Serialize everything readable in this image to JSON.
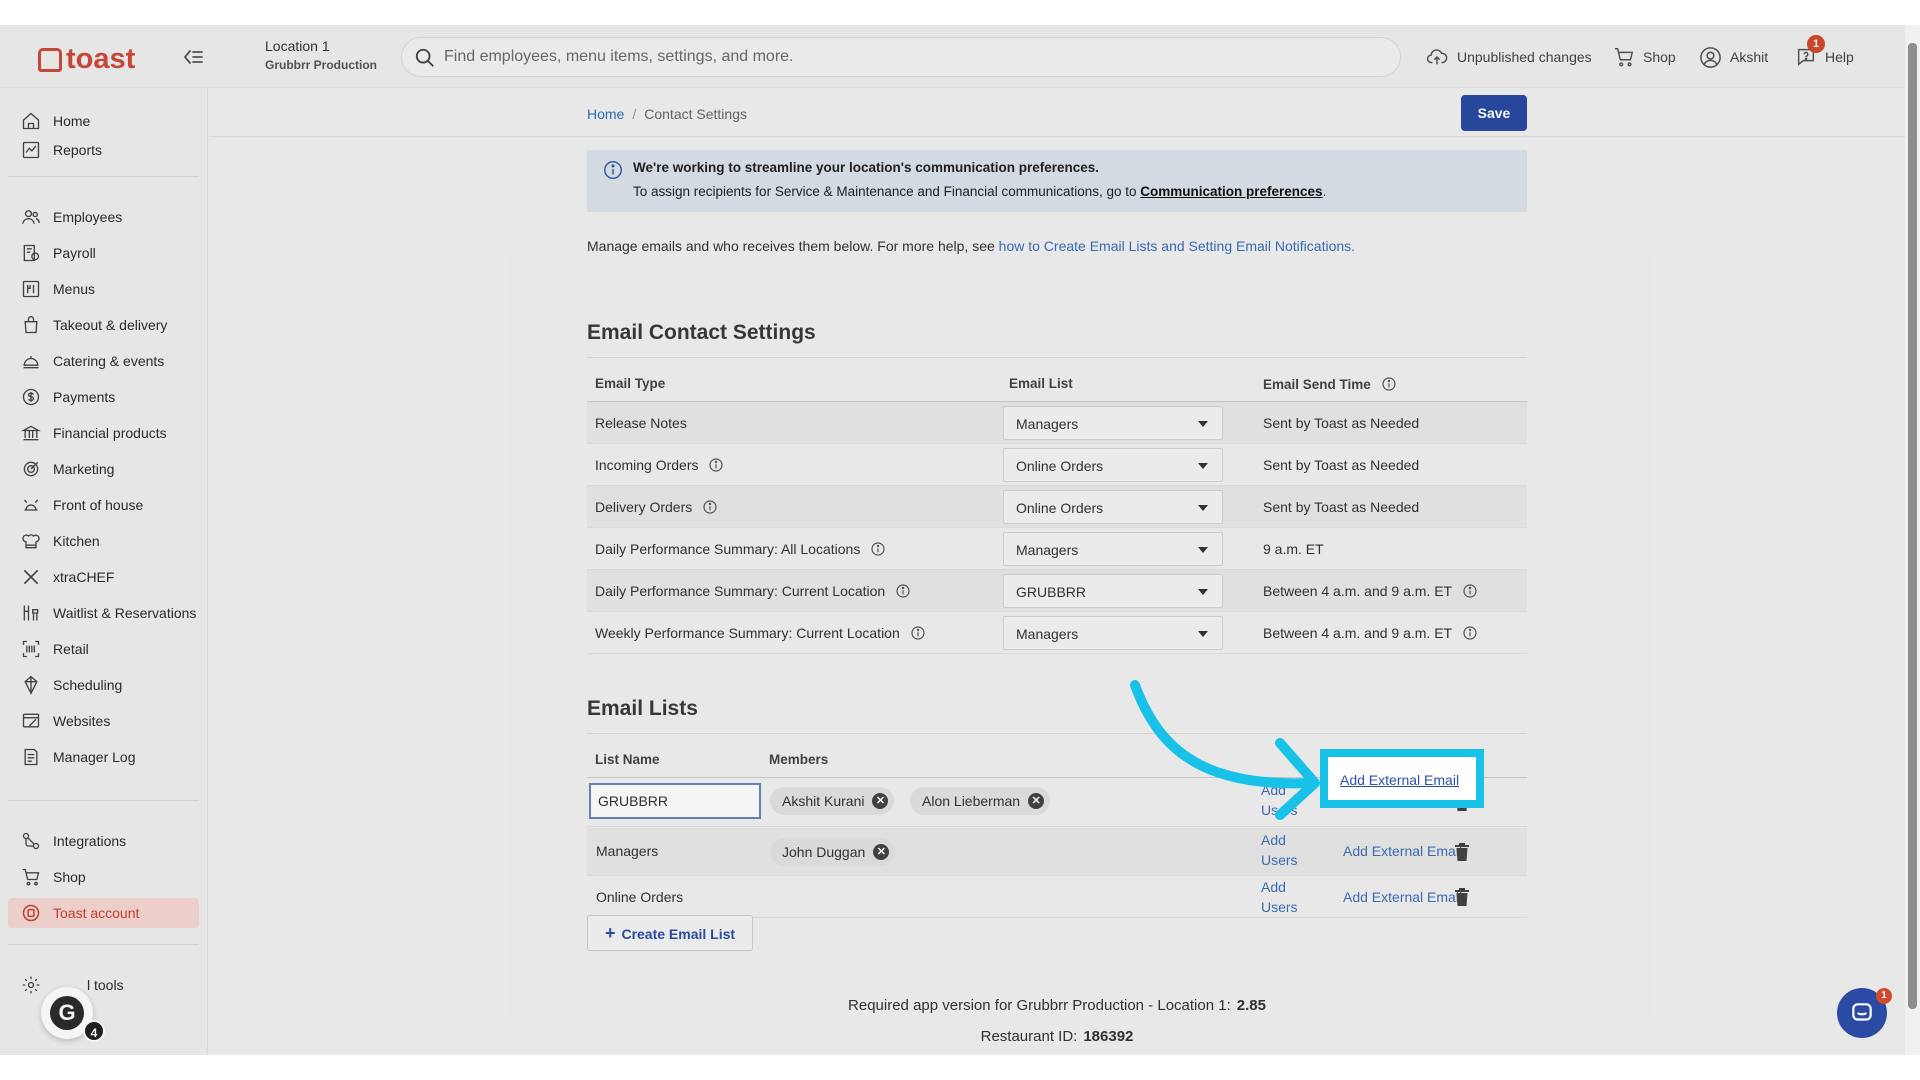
{
  "topbar": {
    "logo_text": "toast",
    "location_name": "Location 1",
    "location_sub": "Grubbrr Production",
    "search_placeholder": "Find employees, menu items, settings, and more.",
    "unpublished_label": "Unpublished changes",
    "shop_label": "Shop",
    "user_label": "Akshit",
    "help_label": "Help",
    "help_badge": "1"
  },
  "sidebar": {
    "items": [
      {
        "label": "Home",
        "icon": "home-icon"
      },
      {
        "label": "Reports",
        "icon": "reports-icon"
      },
      {
        "label": "Employees",
        "icon": "employees-icon"
      },
      {
        "label": "Payroll",
        "icon": "payroll-icon"
      },
      {
        "label": "Menus",
        "icon": "menus-icon"
      },
      {
        "label": "Takeout & delivery",
        "icon": "takeout-icon"
      },
      {
        "label": "Catering & events",
        "icon": "catering-icon"
      },
      {
        "label": "Payments",
        "icon": "payments-icon"
      },
      {
        "label": "Financial products",
        "icon": "bank-icon"
      },
      {
        "label": "Marketing",
        "icon": "marketing-icon"
      },
      {
        "label": "Front of house",
        "icon": "front-of-house-icon"
      },
      {
        "label": "Kitchen",
        "icon": "kitchen-icon"
      },
      {
        "label": "xtraCHEF",
        "icon": "xtrachef-icon"
      },
      {
        "label": "Waitlist & Reservations",
        "icon": "waitlist-icon"
      },
      {
        "label": "Retail",
        "icon": "retail-icon"
      },
      {
        "label": "Scheduling",
        "icon": "scheduling-icon"
      },
      {
        "label": "Websites",
        "icon": "websites-icon"
      },
      {
        "label": "Manager Log",
        "icon": "manager-log-icon"
      },
      {
        "label": "Integrations",
        "icon": "integrations-icon"
      },
      {
        "label": "Shop",
        "icon": "cart-icon"
      },
      {
        "label": "Toast account",
        "icon": "toast-account-icon"
      },
      {
        "label": "l tools",
        "icon": "gear-icon"
      }
    ],
    "avatar_letter": "G",
    "avatar_count": "4"
  },
  "breadcrumb": {
    "home": "Home",
    "current": "Contact Settings"
  },
  "save_label": "Save",
  "banner": {
    "title": "We're working to streamline your location's communication preferences.",
    "body": "To assign recipients for Service & Maintenance and Financial communications, go to ",
    "link": "Communication preferences",
    "end": "."
  },
  "intro": {
    "text": "Manage emails and who receives them below. For more help, see ",
    "link": "how to Create Email Lists and Setting Email Notifications."
  },
  "email_contact": {
    "heading": "Email Contact Settings",
    "headers": {
      "type": "Email Type",
      "list": "Email List",
      "time": "Email Send Time"
    },
    "rows": [
      {
        "type": "Release Notes",
        "list": "Managers",
        "time": "Sent by Toast as Needed"
      },
      {
        "type": "Incoming Orders",
        "list": "Online Orders",
        "time": "Sent by Toast as Needed"
      },
      {
        "type": "Delivery Orders",
        "list": "Online Orders",
        "time": "Sent by Toast as Needed"
      },
      {
        "type": "Daily Performance Summary: All Locations",
        "list": "Managers",
        "time": "9 a.m. ET"
      },
      {
        "type": "Daily Performance Summary: Current Location",
        "list": "GRUBBRR",
        "time": "Between 4 a.m. and 9 a.m. ET"
      },
      {
        "type": "Weekly Performance Summary: Current Location",
        "list": "Managers",
        "time": "Between 4 a.m. and 9 a.m. ET"
      }
    ]
  },
  "email_lists": {
    "heading": "Email Lists",
    "headers": {
      "name": "List Name",
      "members": "Members"
    },
    "add_users": "Add Users",
    "add_external": "Add External Email",
    "rows": [
      {
        "name": "GRUBBRR",
        "members": [
          "Akshit Kurani",
          "Alon Lieberman"
        ]
      },
      {
        "name": "Managers",
        "members": [
          "John Duggan"
        ]
      },
      {
        "name": "Online Orders",
        "members": []
      }
    ],
    "create_label": "Create Email List"
  },
  "footer": {
    "app_version_text": "Required app version for Grubbrr Production - Location 1:",
    "app_version_value": "2.85",
    "restaurant_id_text": "Restaurant ID:",
    "restaurant_id_value": "186392"
  },
  "chat_badge": "1",
  "colors": {
    "brand": "#cf4a3a",
    "primary": "#2a4aa3",
    "link": "#3c6fb8",
    "highlight": "#17c1e8"
  }
}
